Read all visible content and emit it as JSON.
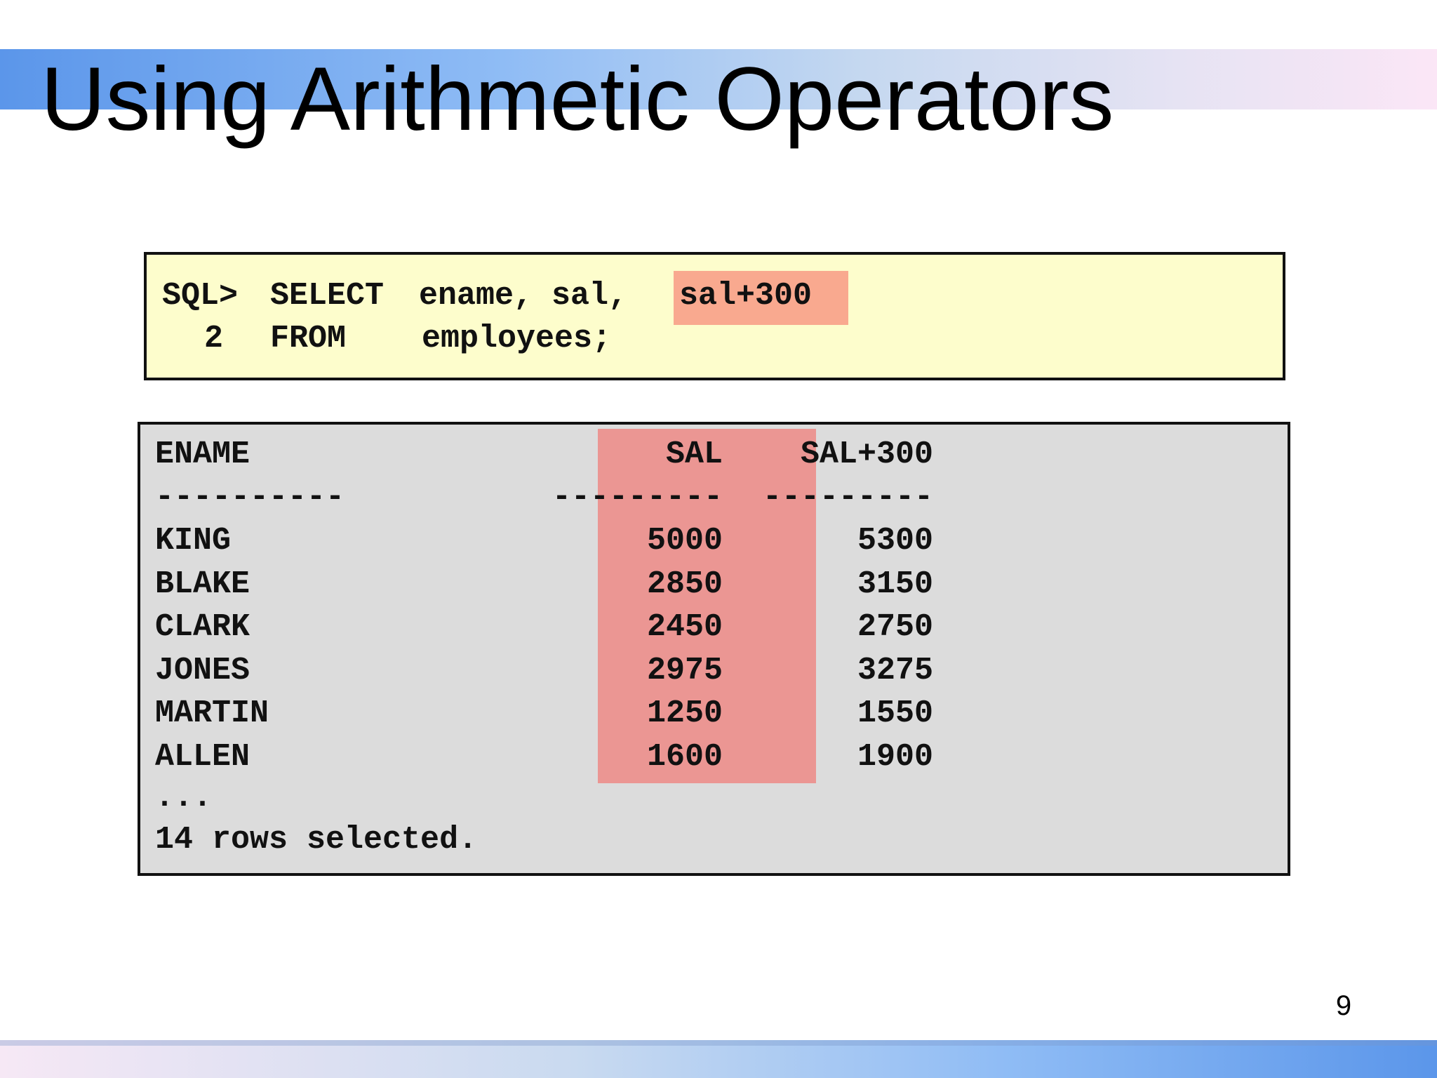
{
  "slide": {
    "title": "Using Arithmetic Operators",
    "page_number": "9"
  },
  "sql": {
    "line1_prompt": "SQL>",
    "line1_keyword": "SELECT",
    "line1_columns": "ename, sal,",
    "line1_expression": "sal+300",
    "line2_number": "2",
    "line2_keyword": "FROM",
    "line2_table": "employees;"
  },
  "result": {
    "headers": [
      "ENAME",
      "SAL",
      "SAL+300"
    ],
    "separators": [
      "----------",
      "---------",
      "---------"
    ],
    "rows": [
      [
        "KING",
        "5000",
        "5300"
      ],
      [
        "BLAKE",
        "2850",
        "3150"
      ],
      [
        "CLARK",
        "2450",
        "2750"
      ],
      [
        "JONES",
        "2975",
        "3275"
      ],
      [
        "MARTIN",
        "1250",
        "1550"
      ],
      [
        "ALLEN",
        "1600",
        "1900"
      ]
    ],
    "ellipsis": "...",
    "footer": "14 rows selected."
  },
  "colors": {
    "sql_background": "#fdfdcc",
    "sql_highlight": "#f9a98f",
    "result_background": "#dcdcdc",
    "column_highlight": "#eb9693"
  }
}
